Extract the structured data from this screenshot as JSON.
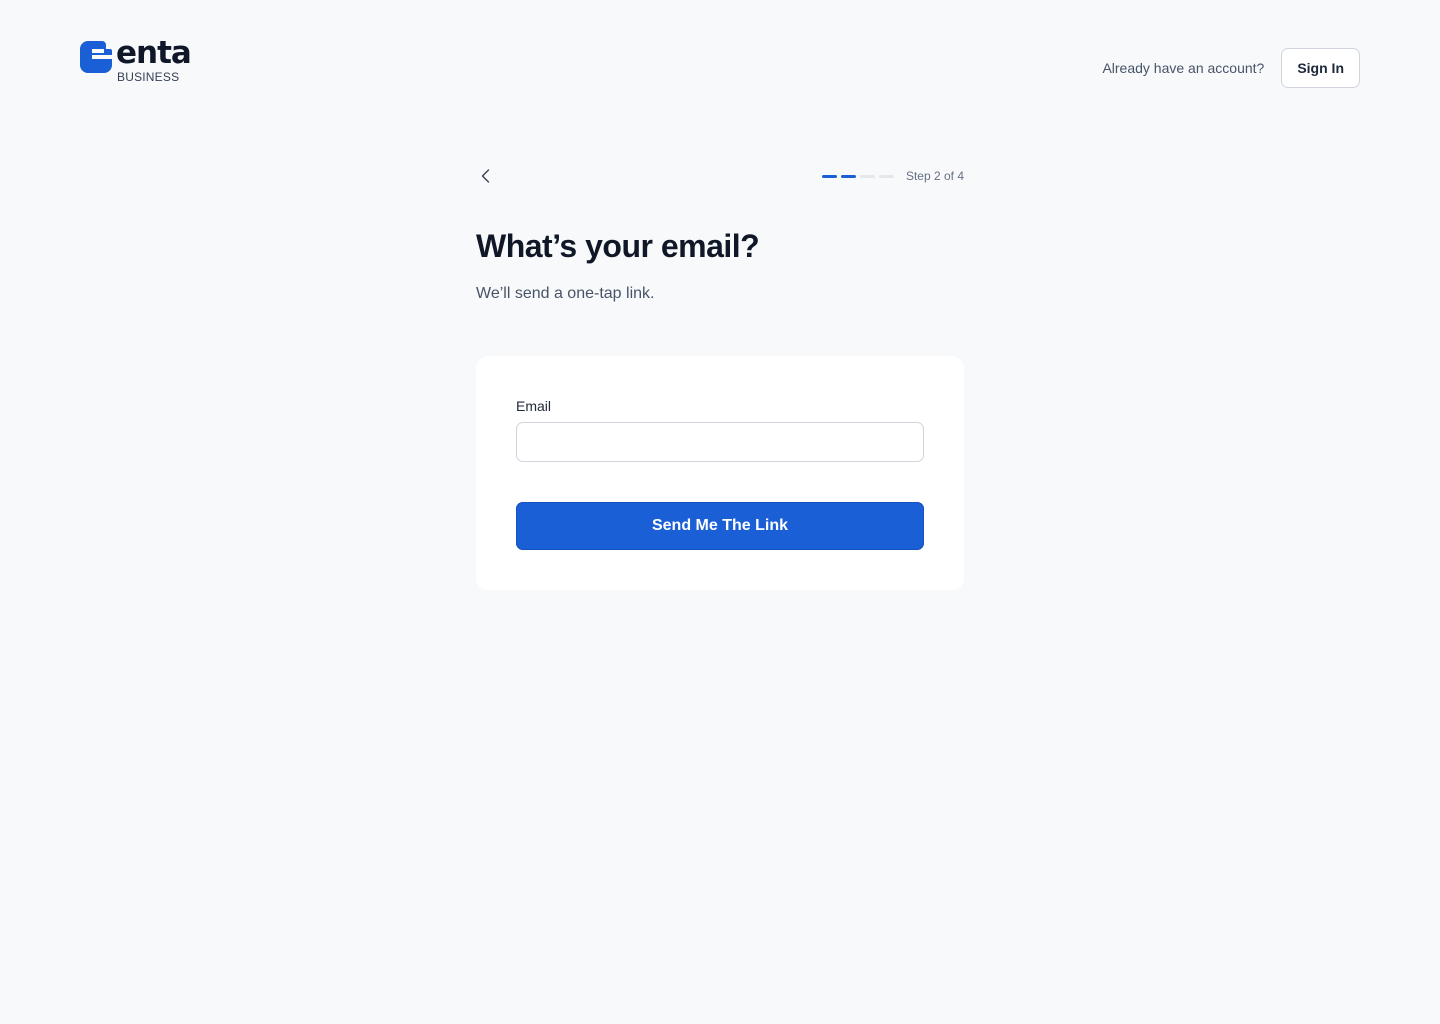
{
  "brand": {
    "name": "enta",
    "sub": "BUSINESS",
    "color": "#1a5fd6"
  },
  "header": {
    "have_account_text": "Already have an account?",
    "signin_label": "Sign In"
  },
  "nav": {
    "back_icon": "chevron-left-icon"
  },
  "progress": {
    "current_step": 2,
    "total_steps": 4,
    "label": "Step 2 of 4"
  },
  "form": {
    "title": "What’s your email?",
    "subtitle": "We’ll send a one-tap link.",
    "email_label": "Email",
    "email_value": "",
    "email_placeholder": "",
    "submit_label": "Send Me The Link"
  }
}
